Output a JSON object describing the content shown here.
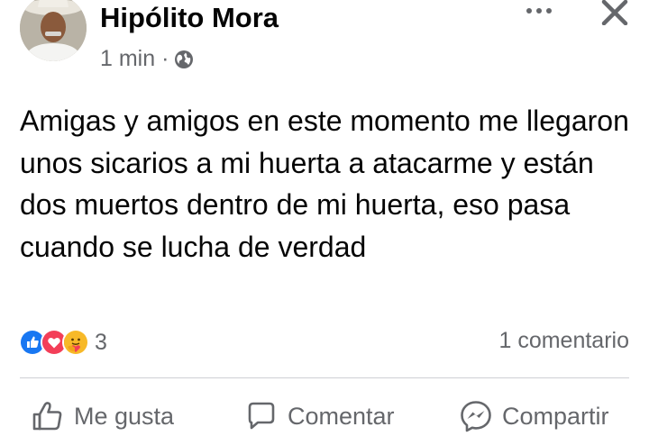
{
  "post": {
    "author": "Hipólito Mora",
    "time": "1 min",
    "separator": "·",
    "visibility_icon": "globe-icon",
    "text": "Amigas y amigos en este momento me llegaron unos sicarios a mi huerta a atacarme y están dos muertos dentro de mi huerta, eso pasa cuando se lucha de verdad"
  },
  "header_icons": [
    "more-options-icon",
    "close-icon"
  ],
  "reactions": {
    "icons": [
      "like-reaction-icon",
      "love-reaction-icon",
      "care-reaction-icon"
    ],
    "count": "3"
  },
  "comments": {
    "count_label": "1 comentario"
  },
  "actions": {
    "like": {
      "label": "Me gusta",
      "icon": "thumbs-up-icon"
    },
    "comment": {
      "label": "Comentar",
      "icon": "comment-bubble-icon"
    },
    "share": {
      "label": "Compartir",
      "icon": "messenger-icon"
    }
  },
  "colors": {
    "text_primary": "#050505",
    "text_secondary": "#65676b",
    "like_blue": "#1877f2",
    "love_red": "#f33e58",
    "care_yellow": "#f7b928"
  }
}
